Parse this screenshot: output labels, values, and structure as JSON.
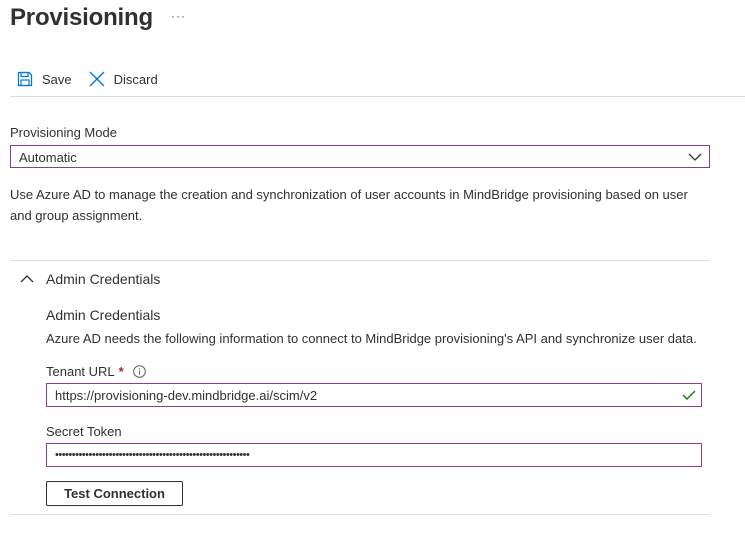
{
  "header": {
    "title": "Provisioning",
    "more_label": "···"
  },
  "toolbar": {
    "save_label": "Save",
    "save_icon": "save-icon",
    "discard_label": "Discard",
    "discard_icon": "close-icon"
  },
  "provisioning_mode": {
    "label": "Provisioning Mode",
    "selected": "Automatic"
  },
  "description": "Use Azure AD to manage the creation and synchronization of user accounts in MindBridge provisioning based on user and group assignment.",
  "admin_credentials": {
    "section_title": "Admin Credentials",
    "expanded": true,
    "heading": "Admin Credentials",
    "description": "Azure AD needs the following information to connect to MindBridge provisioning's API and synchronize user data.",
    "tenant_url": {
      "label": "Tenant URL",
      "required_marker": "*",
      "value": "https://provisioning-dev.mindbridge.ai/scim/v2",
      "valid": true
    },
    "secret_token": {
      "label": "Secret Token",
      "value": "••••••••••••••••••••••••••••••••••••••••••••••••••••••••••"
    },
    "test_button_label": "Test Connection"
  },
  "colors": {
    "accent_border": "#8a3c8f",
    "link_blue": "#0078d4",
    "success_green": "#107c10",
    "required_red": "#a4262c"
  }
}
